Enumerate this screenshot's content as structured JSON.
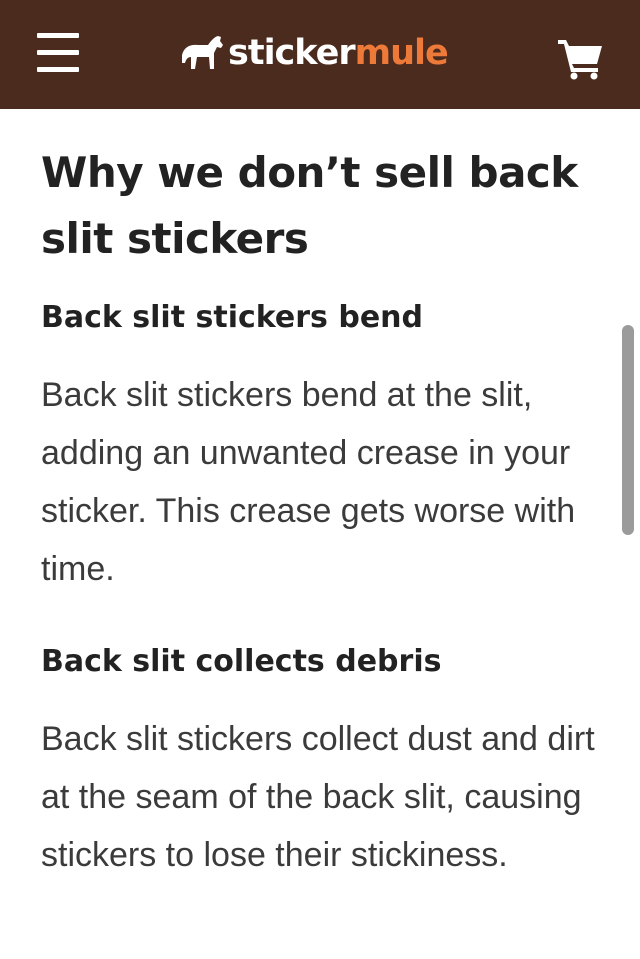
{
  "navbar": {
    "brand_part1": "sticker",
    "brand_part2": "mule",
    "bg_color": "#4a2b1e",
    "accent_color": "#ee7a3a",
    "menu_icon": "hamburger-menu-icon",
    "cart_icon": "shopping-cart-icon",
    "logo_icon": "mule-icon"
  },
  "article": {
    "title": "Why we don’t sell back slit stickers",
    "sections": [
      {
        "heading": "Back slit stickers bend",
        "body": "Back slit stickers bend at the slit, adding an unwanted crease in your sticker. This crease gets worse with time."
      },
      {
        "heading": "Back slit collects debris",
        "body": "Back slit stickers collect dust and dirt at the seam of the back slit, causing stickers to lose their stickiness."
      }
    ]
  }
}
